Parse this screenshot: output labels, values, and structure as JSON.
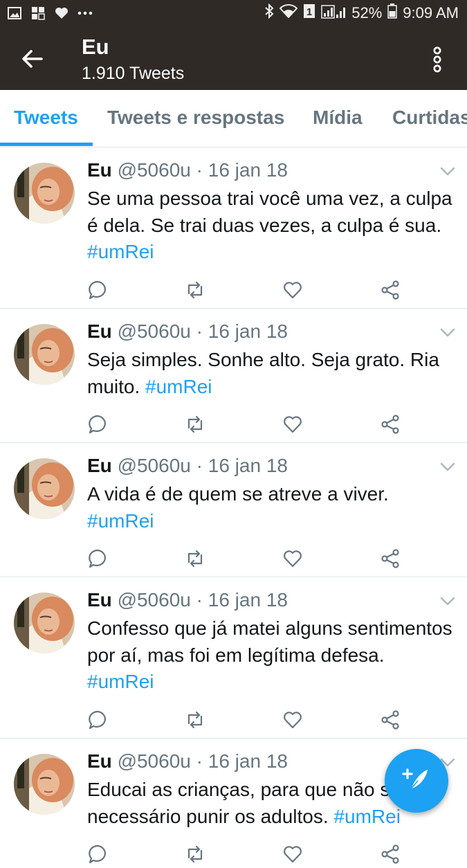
{
  "status_bar": {
    "battery": "52%",
    "time": "9:09 AM",
    "left_icons": [
      "image-icon",
      "flipboard-icon",
      "heart-icon",
      "more-dots-icon"
    ],
    "right_icons": [
      "bluetooth-icon",
      "wifi-icon",
      "sim-1-icon",
      "signal-icon",
      "battery-icon"
    ]
  },
  "header": {
    "title": "Eu",
    "subtitle": "1.910 Tweets",
    "back_icon": "back-arrow-icon",
    "menu_icon": "overflow-menu-icon"
  },
  "tabs": [
    {
      "label": "Tweets",
      "active": true
    },
    {
      "label": "Tweets e respostas",
      "active": false
    },
    {
      "label": "Mídia",
      "active": false
    },
    {
      "label": "Curtidas",
      "active": false
    }
  ],
  "tweets": [
    {
      "name": "Eu",
      "handle": "@5060u",
      "sep": " · ",
      "date": "16 jan 18",
      "text": "Se uma pessoa trai você uma vez, a culpa é dela. Se trai duas vezes, a culpa é sua.",
      "hashtag": "#umRei"
    },
    {
      "name": "Eu",
      "handle": "@5060u",
      "sep": " · ",
      "date": "16 jan 18",
      "text": "Seja simples. Sonhe alto. Seja grato. Ria muito.",
      "hashtag": "#umRei"
    },
    {
      "name": "Eu",
      "handle": "@5060u",
      "sep": " · ",
      "date": "16 jan 18",
      "text": "A vida é de quem se atreve a viver.",
      "hashtag": "#umRei"
    },
    {
      "name": "Eu",
      "handle": "@5060u",
      "sep": " · ",
      "date": "16 jan 18",
      "text": "Confesso que já matei alguns sentimentos por aí, mas foi em legítima defesa.",
      "hashtag": "#umRei"
    },
    {
      "name": "Eu",
      "handle": "@5060u",
      "sep": " · ",
      "date": "16 jan 18",
      "text": "Educai as crianças, para que não seja necessário punir os adultos.",
      "hashtag": "#umRei"
    }
  ],
  "tweet_action_icons": [
    "reply-icon",
    "retweet-icon",
    "like-icon",
    "share-icon"
  ],
  "fab": {
    "icon": "compose-tweet-icon"
  },
  "colors": {
    "accent": "#1da1f2",
    "header_bg": "#2f2a26",
    "muted": "#66757f",
    "divider": "#dfe3e6"
  }
}
